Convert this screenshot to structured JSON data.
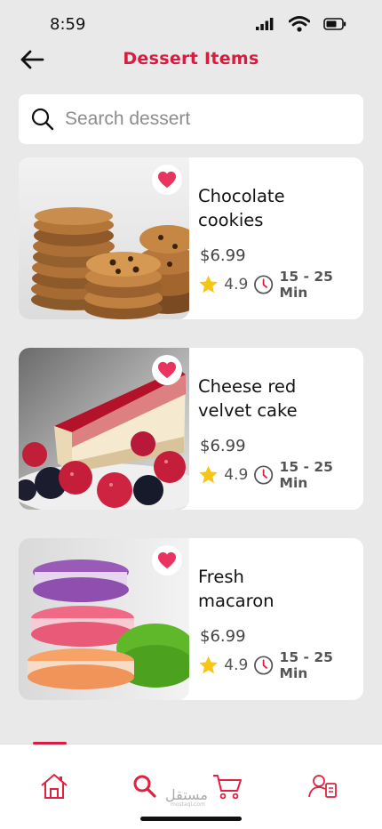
{
  "status_bar": {
    "time": "8:59"
  },
  "header": {
    "title": "Dessert  Items"
  },
  "search": {
    "placeholder": "Search dessert"
  },
  "items": [
    {
      "name": "Chocolate\ncookies",
      "price": "$6.99",
      "rating": "4.9",
      "time": "15 - 25 Min",
      "favorite": true
    },
    {
      "name": "Cheese red\nvelvet cake",
      "price": "$6.99",
      "rating": "4.9",
      "time": "15 - 25 Min",
      "favorite": true
    },
    {
      "name": "Fresh\n macaron",
      "price": "$6.99",
      "rating": "4.9",
      "time": "15 - 25 Min",
      "favorite": true
    }
  ],
  "nav": {
    "items": [
      {
        "icon": "home-icon"
      },
      {
        "icon": "search-icon",
        "active": true
      },
      {
        "icon": "cart-icon"
      },
      {
        "icon": "profile-icon"
      }
    ]
  },
  "watermark": {
    "text": "مستقل",
    "sub": "mostaql.com"
  },
  "colors": {
    "accent": "#d81b3f",
    "heart": "#e8345f",
    "star": "#f5c518",
    "background": "#e9e9e9"
  }
}
